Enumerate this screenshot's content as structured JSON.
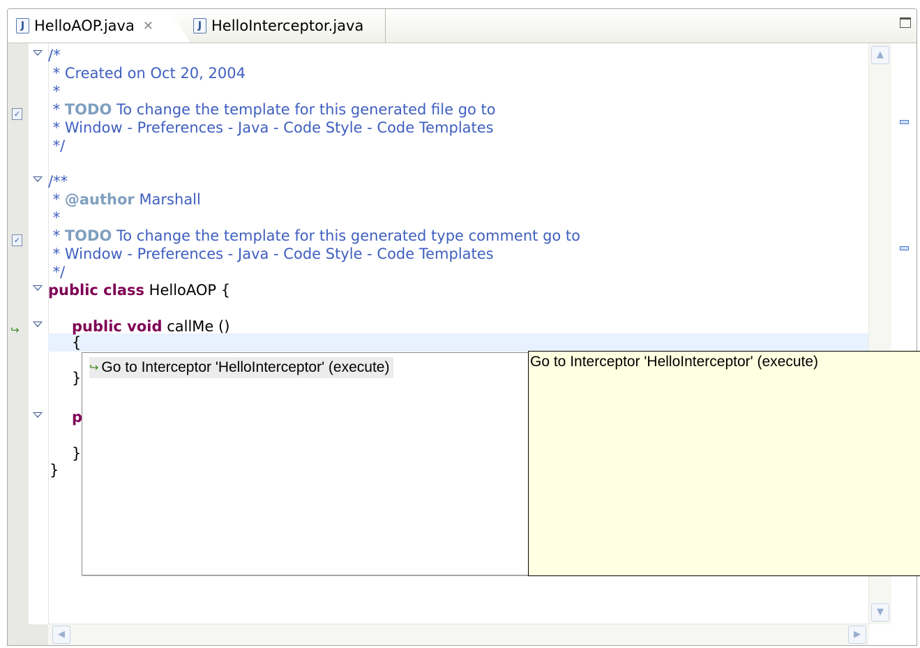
{
  "tabs": [
    {
      "label": "HelloAOP.java",
      "icon": "java-file-icon",
      "close": "✕",
      "active": true
    },
    {
      "label": "HelloInterceptor.java",
      "icon": "java-file-icon",
      "active": false
    }
  ],
  "code": {
    "l1": "/*",
    "l2": " * Created on Oct 20, 2004",
    "l3": " *",
    "l4_pre": " * ",
    "l4_tag": "TODO",
    "l4_rest": " To change the template for this generated file go to",
    "l5": " * Window - Preferences - Java - Code Style - Code Templates",
    "l6": " */",
    "l7": "/**",
    "l8_pre": " * ",
    "l8_tag": "@author",
    "l8_rest": " Marshall",
    "l9": " *",
    "l10_pre": " * ",
    "l10_tag": "TODO",
    "l10_rest": " To change the template for this generated type comment go to",
    "l11": " * Window - Preferences - Java - Code Style - Code Templates",
    "l12": " */",
    "l13_kw": "public class",
    "l13_rest": " HelloAOP {",
    "l14_kw": "public void",
    "l14_rest": " callMe ()",
    "l15": "{",
    "l16": "}",
    "l17_kw": "p",
    "l18": "}",
    "l19": "}"
  },
  "popup": {
    "item_label": "Go to Interceptor 'HelloInterceptor' (execute)",
    "item_icon": "interceptor-icon",
    "info_text": "Go to Interceptor 'HelloInterceptor' (execute)"
  },
  "colors": {
    "comment": "#3f5fbf",
    "keyword": "#7f0055",
    "javadoc_tag": "#7f9fbf",
    "info_background": "#ffffe1",
    "current_line": "#e8f2fe"
  }
}
